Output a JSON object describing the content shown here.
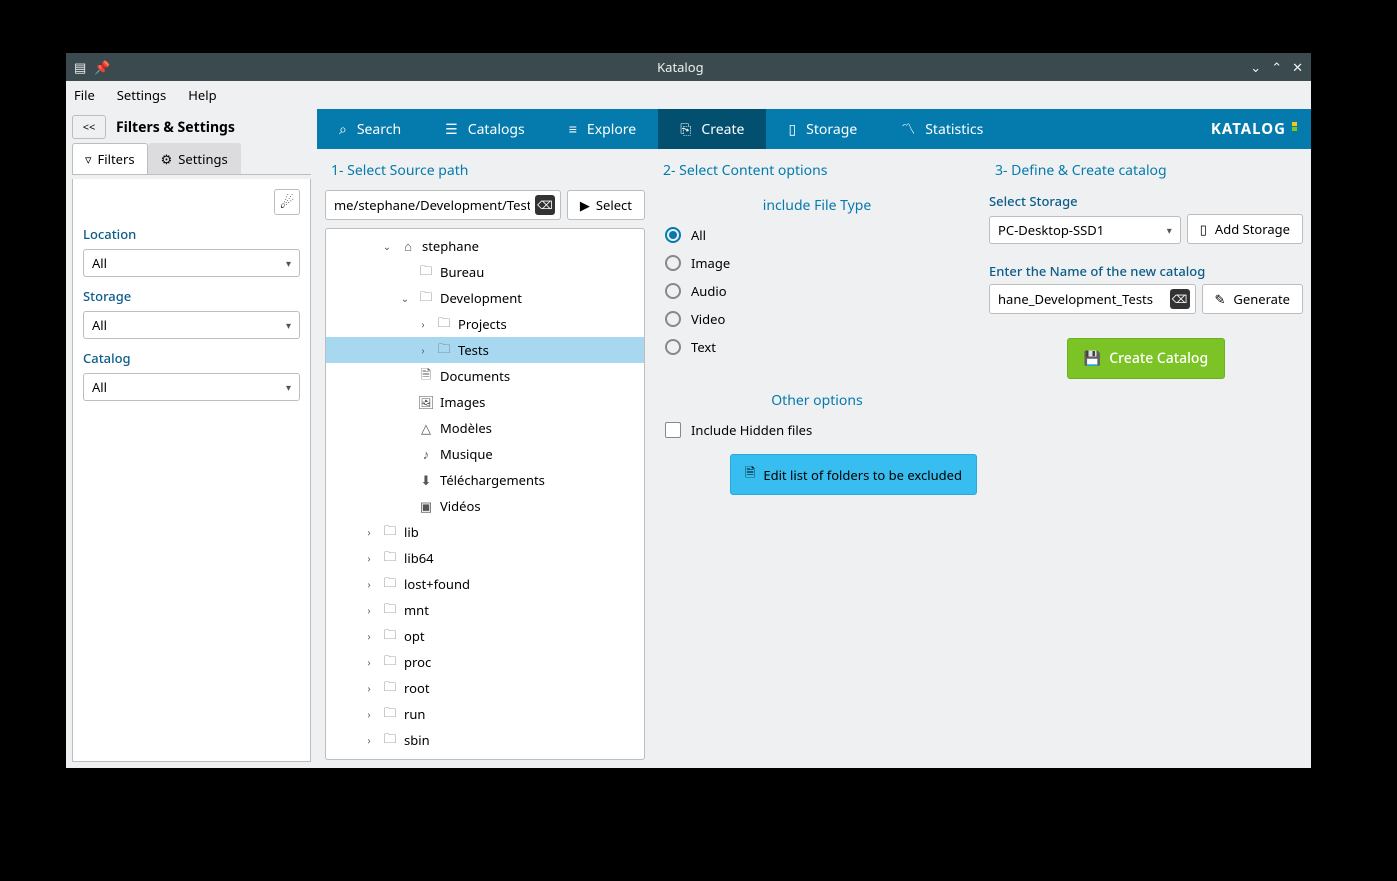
{
  "window": {
    "title": "Katalog"
  },
  "menubar": [
    "File",
    "Settings",
    "Help"
  ],
  "sidebar": {
    "collapse": "<<",
    "title": "Filters & Settings",
    "tabs": {
      "filters": "Filters",
      "settings": "Settings"
    },
    "location": {
      "label": "Location",
      "value": "All"
    },
    "storage": {
      "label": "Storage",
      "value": "All"
    },
    "catalog": {
      "label": "Catalog",
      "value": "All"
    }
  },
  "maintabs": {
    "search": "Search",
    "catalogs": "Catalogs",
    "explore": "Explore",
    "create": "Create",
    "storage": "Storage",
    "statistics": "Statistics",
    "brand": "KATALOG"
  },
  "col1": {
    "head": "1-    Select Source path",
    "path": "me/stephane/Development/Tests",
    "select_btn": "Select",
    "tree": [
      {
        "depth": 3,
        "exp": "v",
        "icon": "home",
        "label": "stephane"
      },
      {
        "depth": 4,
        "exp": "",
        "icon": "folder",
        "label": "Bureau"
      },
      {
        "depth": 4,
        "exp": "v",
        "icon": "folder",
        "label": "Development"
      },
      {
        "depth": 5,
        "exp": ">",
        "icon": "folder",
        "label": "Projects"
      },
      {
        "depth": 5,
        "exp": ">",
        "icon": "folder",
        "label": "Tests",
        "sel": true
      },
      {
        "depth": 4,
        "exp": "",
        "icon": "doc",
        "label": "Documents"
      },
      {
        "depth": 4,
        "exp": "",
        "icon": "image",
        "label": "Images"
      },
      {
        "depth": 4,
        "exp": "",
        "icon": "template",
        "label": "Modèles"
      },
      {
        "depth": 4,
        "exp": "",
        "icon": "music",
        "label": "Musique"
      },
      {
        "depth": 4,
        "exp": "",
        "icon": "download",
        "label": "Téléchargements"
      },
      {
        "depth": 4,
        "exp": "",
        "icon": "video",
        "label": "Vidéos"
      },
      {
        "depth": 2,
        "exp": ">",
        "icon": "folder",
        "label": "lib"
      },
      {
        "depth": 2,
        "exp": ">",
        "icon": "folder",
        "label": "lib64"
      },
      {
        "depth": 2,
        "exp": ">",
        "icon": "folder",
        "label": "lost+found"
      },
      {
        "depth": 2,
        "exp": ">",
        "icon": "folder",
        "label": "mnt"
      },
      {
        "depth": 2,
        "exp": ">",
        "icon": "folder",
        "label": "opt"
      },
      {
        "depth": 2,
        "exp": ">",
        "icon": "folder",
        "label": "proc"
      },
      {
        "depth": 2,
        "exp": ">",
        "icon": "folder",
        "label": "root"
      },
      {
        "depth": 2,
        "exp": ">",
        "icon": "folder",
        "label": "run"
      },
      {
        "depth": 2,
        "exp": ">",
        "icon": "folder",
        "label": "sbin"
      }
    ]
  },
  "col2": {
    "head": "2-    Select Content options",
    "filetype_label": "include File Type",
    "filetypes": [
      {
        "label": "All",
        "sel": true
      },
      {
        "label": "Image",
        "sel": false
      },
      {
        "label": "Audio",
        "sel": false
      },
      {
        "label": "Video",
        "sel": false
      },
      {
        "label": "Text",
        "sel": false
      }
    ],
    "other_label": "Other options",
    "hidden": "Include Hidden files",
    "edit_btn": "Edit list of folders to be excluded"
  },
  "col3": {
    "head": "3-    Define & Create catalog",
    "storage_label": "Select Storage",
    "storage_value": "PC-Desktop-SSD1",
    "add_storage": "Add Storage",
    "name_label": "Enter the Name of the new catalog",
    "name_value": "hane_Development_Tests",
    "generate": "Generate",
    "create": "Create Catalog"
  }
}
